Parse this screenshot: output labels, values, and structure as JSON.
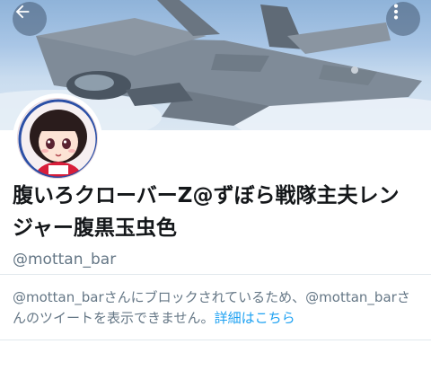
{
  "header": {
    "back_icon": "arrow-left-icon",
    "more_icon": "more-vertical-icon",
    "banner_alt": "fighter jet in sky"
  },
  "profile": {
    "display_name": "腹いろクローバーZ@ずぼら戦隊主夫レンジャー腹黒玉虫色",
    "handle": "@mottan_bar"
  },
  "notice": {
    "text": "@mottan_barさんにブロックされているため、@mottan_barさんのツイートを表示できません。",
    "link": "詳細はこちら"
  },
  "colors": {
    "link": "#1da1f2",
    "secondary_text": "#657786",
    "divider": "#e1e8ed"
  }
}
